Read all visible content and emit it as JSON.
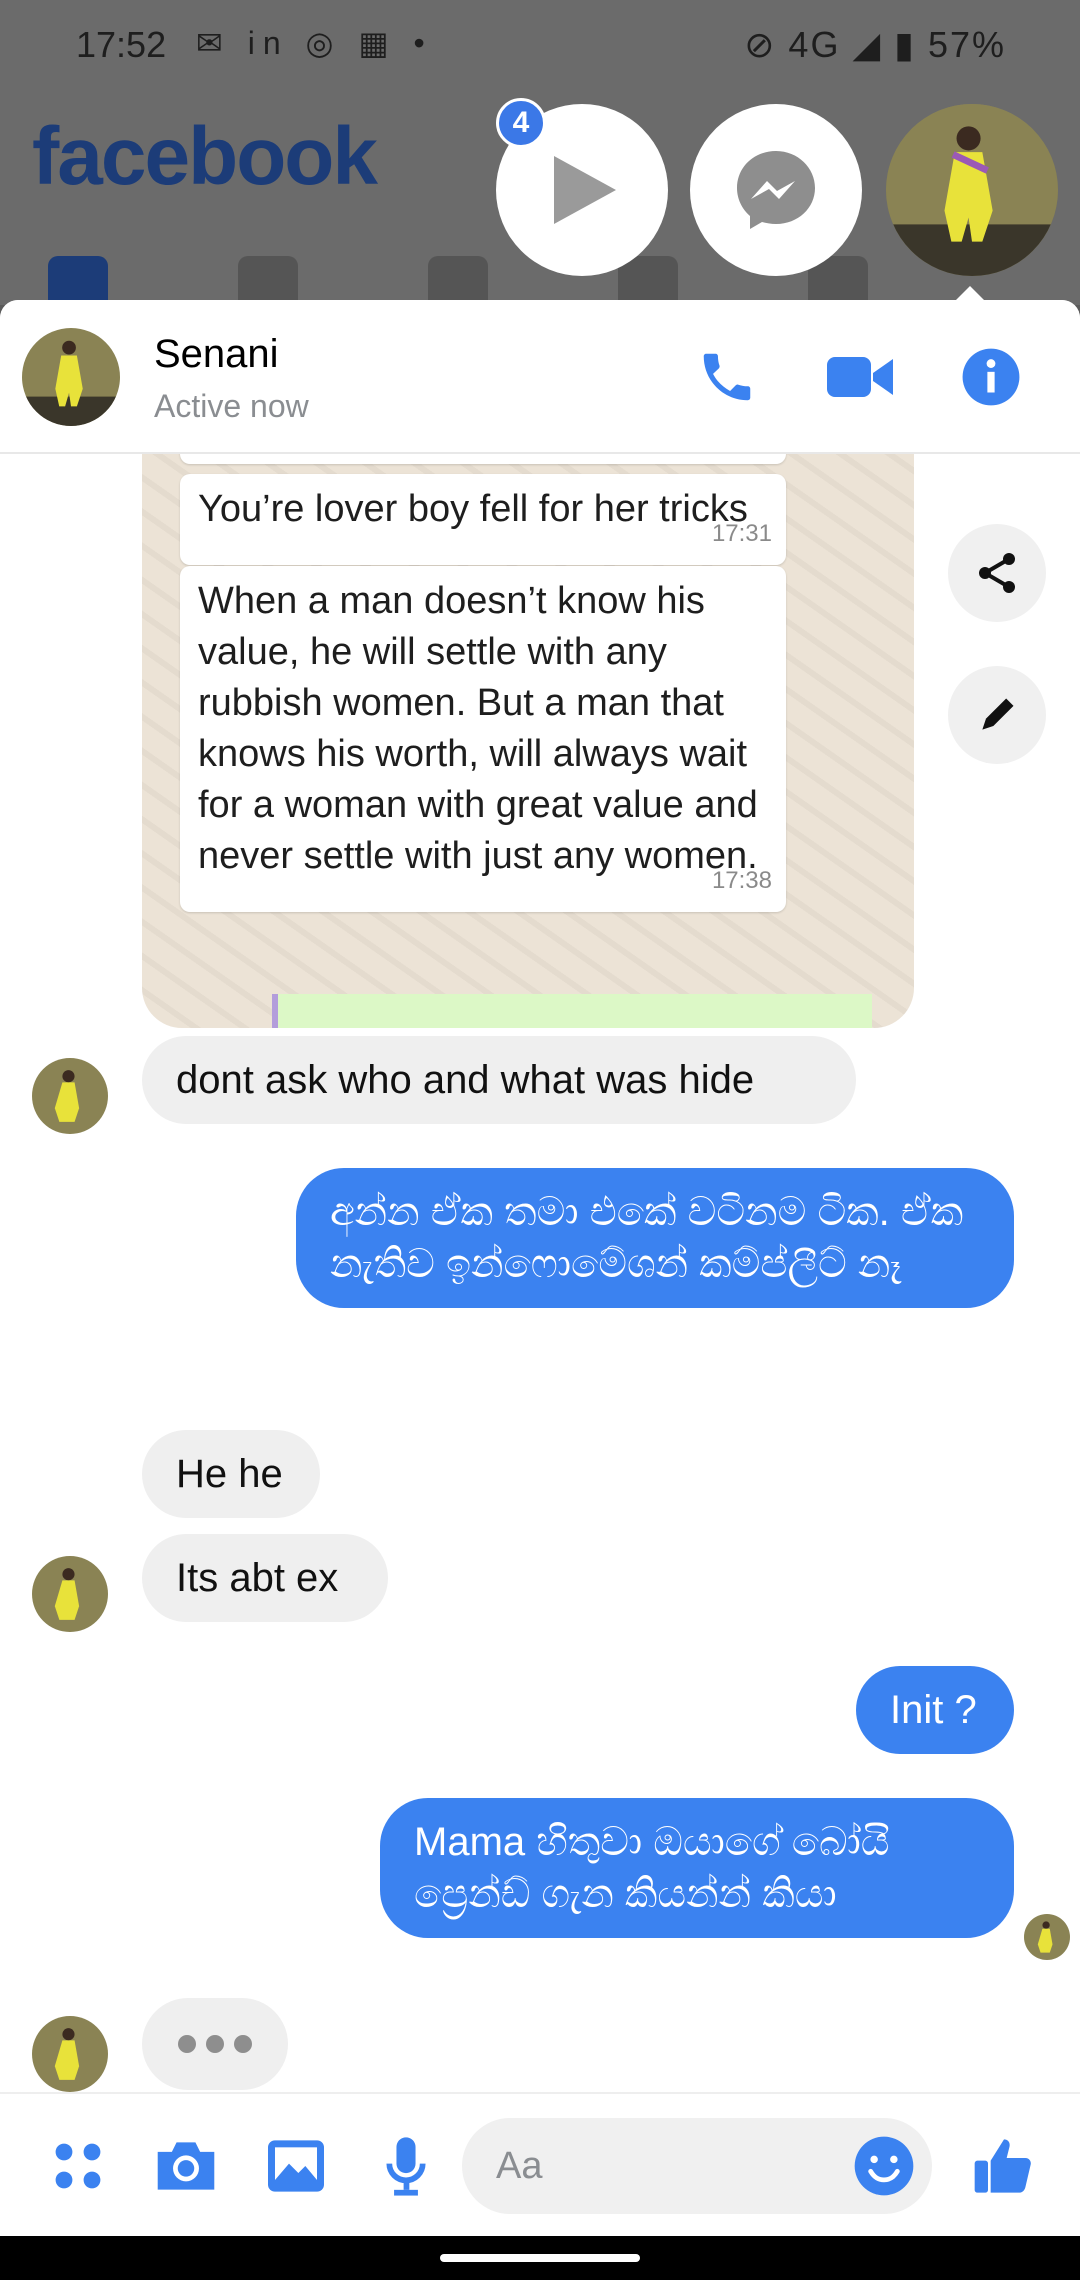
{
  "statusbar": {
    "time": "17:52",
    "icons": "✉ in ◎ ▦ •",
    "right": "⊘ 4G ◢ ▮ 57%"
  },
  "background": {
    "logo": "facebook"
  },
  "chat_heads": {
    "badge_count": "4"
  },
  "header": {
    "name": "Senani",
    "status": "Active now"
  },
  "screenshot": {
    "bubbles": [
      {
        "text": "You’re lover boy fell for her tricks",
        "time": "17:31"
      },
      {
        "text": "When a man doesn’t know his value, he will settle with any rubbish women. But a man that knows his worth, will always wait for a woman with great value and never settle with just any women.",
        "time": "17:38"
      }
    ]
  },
  "messages": [
    {
      "text": "dont ask who and what was  hide",
      "direction": "in"
    },
    {
      "text": "අන්න ඒක තමා එකේ වටිනම ටික. ඒක නැතිව ඉන්ෆොමේශන් කම්ප්ලීට් නෑ",
      "direction": "out"
    },
    {
      "text": "He he",
      "direction": "in"
    },
    {
      "text": "Its abt ex",
      "direction": "in"
    },
    {
      "text": "Init ?",
      "direction": "out"
    },
    {
      "text": "Mama හිතුවා ඔයාගේ බෝයි ප්‍රෙන්ඩ් ගැන කියන්න් කියා",
      "direction": "out"
    }
  ],
  "composer": {
    "placeholder": "Aa"
  },
  "colors": {
    "accent": "#3b82f0",
    "incoming_bubble": "#efefef",
    "facebook_blue": "#1c3c78"
  }
}
